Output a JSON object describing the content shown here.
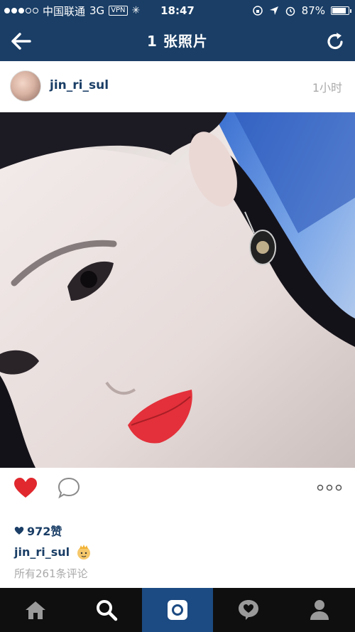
{
  "status_bar": {
    "carrier": "中国联通",
    "network": "3G",
    "vpn": "VPN",
    "time": "18:47",
    "battery_percent": "87%",
    "battery_level": 0.87,
    "signal_dots_filled": 3,
    "signal_dots_total": 5
  },
  "nav": {
    "title": "1 张照片",
    "back_icon": "arrow-left-icon",
    "refresh_icon": "refresh-icon"
  },
  "post": {
    "username": "jin_ri_sul",
    "time_ago": "1小时"
  },
  "actions": {
    "like_icon": "heart-icon",
    "comment_icon": "comment-bubble-icon",
    "more_icon": "more-dots-icon",
    "liked": true
  },
  "likes": {
    "count": "972赞"
  },
  "caption": {
    "username": "jin_ri_sul",
    "emoji": "princess-emoji"
  },
  "comments": {
    "link_text": "所有261条评论"
  },
  "tabs": [
    {
      "name": "home",
      "icon": "home-icon",
      "active": false
    },
    {
      "name": "explore",
      "icon": "search-icon",
      "active": false
    },
    {
      "name": "camera",
      "icon": "camera-icon",
      "active": true
    },
    {
      "name": "activity",
      "icon": "activity-heart-bubble-icon",
      "active": false
    },
    {
      "name": "profile",
      "icon": "person-icon",
      "active": false
    }
  ],
  "colors": {
    "nav_bg": "#1a3e66",
    "accent": "#1c4a82",
    "like_red": "#e0282e",
    "tab_bg": "#0f0f0f"
  }
}
